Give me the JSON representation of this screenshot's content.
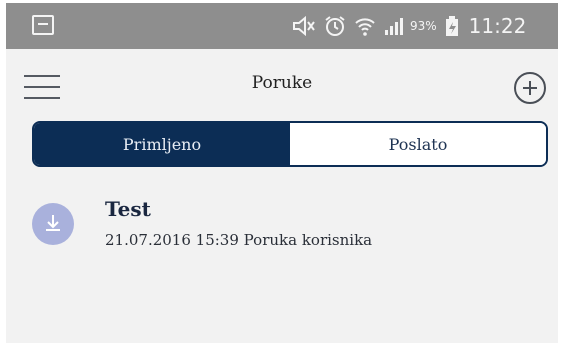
{
  "status_bar": {
    "icons": [
      "gallery-icon",
      "mute-icon",
      "alarm-icon",
      "wifi-icon",
      "signal-icon",
      "battery-icon"
    ],
    "battery_percent": "93%",
    "time": "11:22"
  },
  "header": {
    "title": "Poruke",
    "menu_icon": "hamburger-icon",
    "add_icon": "plus-circle-icon"
  },
  "tabs": [
    {
      "label": "Primljeno",
      "active": true
    },
    {
      "label": "Poslato",
      "active": false
    }
  ],
  "messages": [
    {
      "title": "Test",
      "date": "21.07.2016 15:39",
      "sender": "Poruka korisnika",
      "icon": "download-icon"
    }
  ],
  "colors": {
    "status_bar": "#8e8e8e",
    "background": "#f2f2f2",
    "accent": "#0c2d55",
    "avatar": "#a9b1dc"
  }
}
